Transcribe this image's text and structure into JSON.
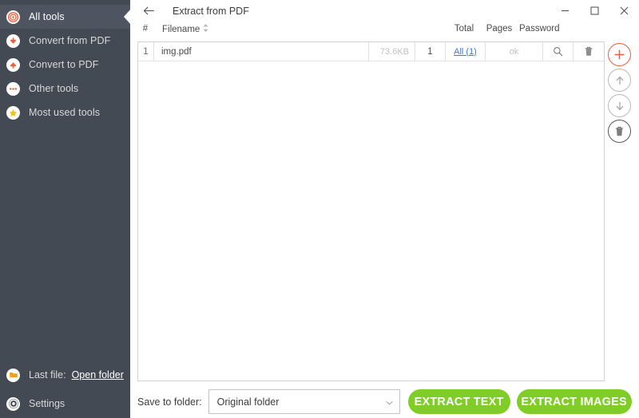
{
  "window": {
    "title": "Extract from PDF",
    "back_icon": "arrow-left-icon",
    "controls": {
      "minimize": "–",
      "maximize": "□",
      "close": "✕"
    }
  },
  "sidebar": {
    "background": "#434a54",
    "items": [
      {
        "label": "All tools",
        "icon": "target-icon",
        "icon_color": "#e8603c",
        "active": true
      },
      {
        "label": "Convert from PDF",
        "icon": "arrow-down-icon",
        "icon_color": "#e8603c",
        "active": false
      },
      {
        "label": "Convert to PDF",
        "icon": "arrow-up-icon",
        "icon_color": "#e8603c",
        "active": false
      },
      {
        "label": "Other tools",
        "icon": "dots-icon",
        "icon_color": "#e8603c",
        "active": false
      },
      {
        "label": "Most used tools",
        "icon": "star-icon",
        "icon_color": "#f2c017",
        "active": false
      }
    ],
    "bottom": {
      "last_file_label": "Last file:",
      "last_file_icon": "folder-icon",
      "open_folder_link": "Open folder",
      "settings_label": "Settings",
      "settings_icon": "gear-icon"
    }
  },
  "table": {
    "headers": {
      "number": "#",
      "filename": "Filename",
      "total": "Total",
      "pages": "Pages",
      "password": "Password"
    },
    "sort_icon": "sort-updown-icon",
    "rows": [
      {
        "number": "1",
        "filename": "img.pdf",
        "size": "73.6KB",
        "total": "1",
        "pages": "All (1)",
        "password": "ok",
        "search_icon": "magnifier-icon",
        "delete_icon": "trash-icon"
      }
    ]
  },
  "action_rail": {
    "buttons": [
      {
        "name": "add-files-button",
        "icon": "plus-icon",
        "accent": "#e8603c"
      },
      {
        "name": "move-up-button",
        "icon": "arrow-up-icon",
        "accent": "#b9b9b9"
      },
      {
        "name": "move-down-button",
        "icon": "arrow-down-icon",
        "accent": "#b9b9b9"
      },
      {
        "name": "clear-list-button",
        "icon": "trash-icon",
        "accent": "#5a5a5a"
      }
    ]
  },
  "footer": {
    "save_to_folder_label": "Save to folder:",
    "folder_value": "Original folder",
    "folder_dropdown_icon": "chevron-down-icon",
    "extract_text_button": "EXTRACT TEXT",
    "extract_images_button": "EXTRACT IMAGES",
    "button_color": "#80cd28"
  }
}
